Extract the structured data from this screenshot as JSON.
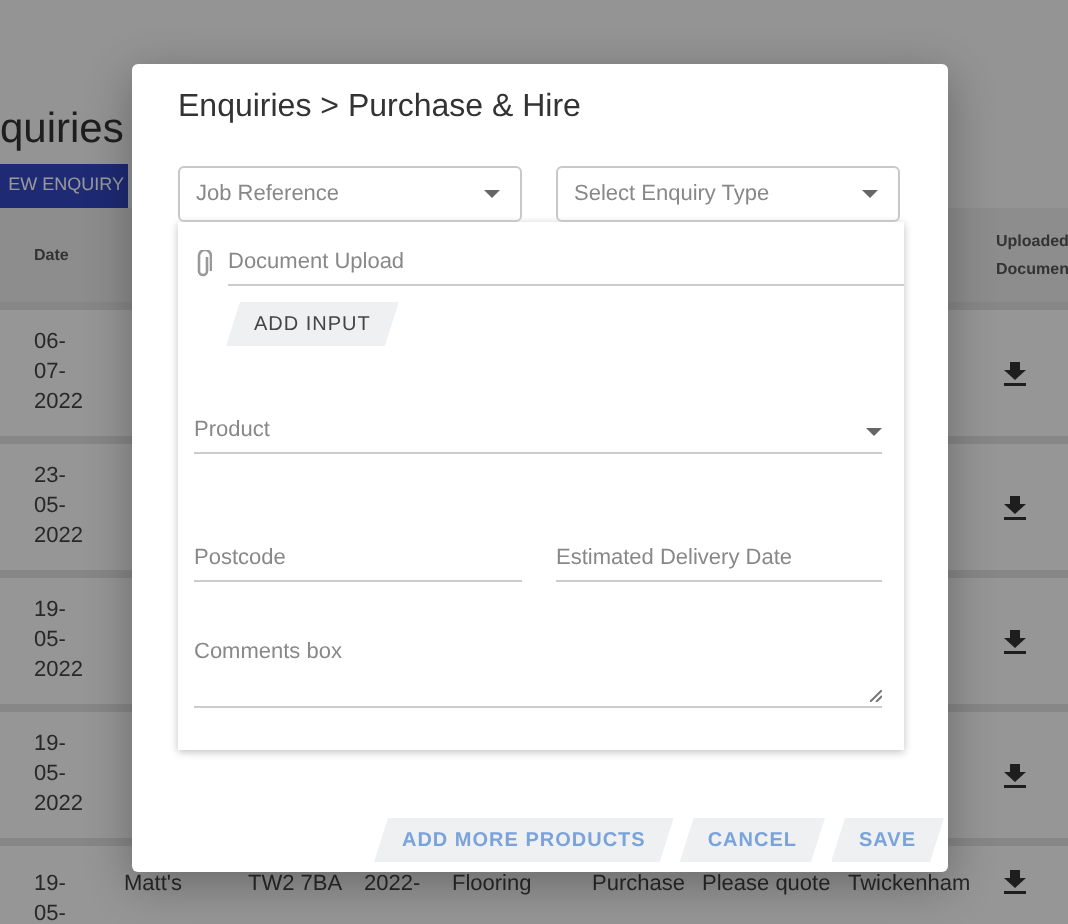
{
  "background": {
    "heading": "quiries",
    "new_button": "EW ENQUIRY",
    "date_header": "Date",
    "docs_header": "Uploaded Documen",
    "rows": [
      {
        "date": "06-07-2022"
      },
      {
        "date": "23-05-2022"
      },
      {
        "date": "19-05-2022"
      },
      {
        "date": "19-05-2022"
      },
      {
        "date": "19-05-",
        "cells": [
          "Matt's",
          "TW2 7BA",
          "2022-",
          "Flooring",
          "Purchase",
          "Please quote",
          "Twickenham"
        ]
      }
    ]
  },
  "modal": {
    "title": "Enquiries > Purchase & Hire",
    "selects": [
      {
        "placeholder": "Job Reference"
      },
      {
        "placeholder": "Select Enquiry Type"
      }
    ],
    "upload": {
      "placeholder": "Document Upload"
    },
    "add_input": "ADD INPUT",
    "product": {
      "placeholder": "Product"
    },
    "postcode": {
      "placeholder": "Postcode"
    },
    "delivery_date": {
      "placeholder": "Estimated Delivery Date"
    },
    "comments": {
      "placeholder": "Comments box"
    },
    "buttons": [
      "ADD MORE PRODUCTS",
      "CANCEL",
      "SAVE"
    ]
  }
}
